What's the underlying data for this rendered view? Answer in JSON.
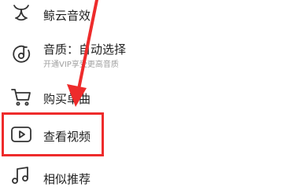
{
  "menu": {
    "items": [
      {
        "label": "鲸云音效",
        "icon": "whale-icon"
      },
      {
        "label": "音质：自动选择",
        "sublabel": "开通VIP享受更高音质",
        "icon": "music-disc-icon"
      },
      {
        "label": "购买单曲",
        "icon": "shopping-cart-icon"
      },
      {
        "label": "查看视频",
        "icon": "video-play-icon"
      },
      {
        "label": "相似推荐",
        "icon": "music-note-icon"
      }
    ]
  },
  "annotation": {
    "color": "#ee2b2b"
  }
}
